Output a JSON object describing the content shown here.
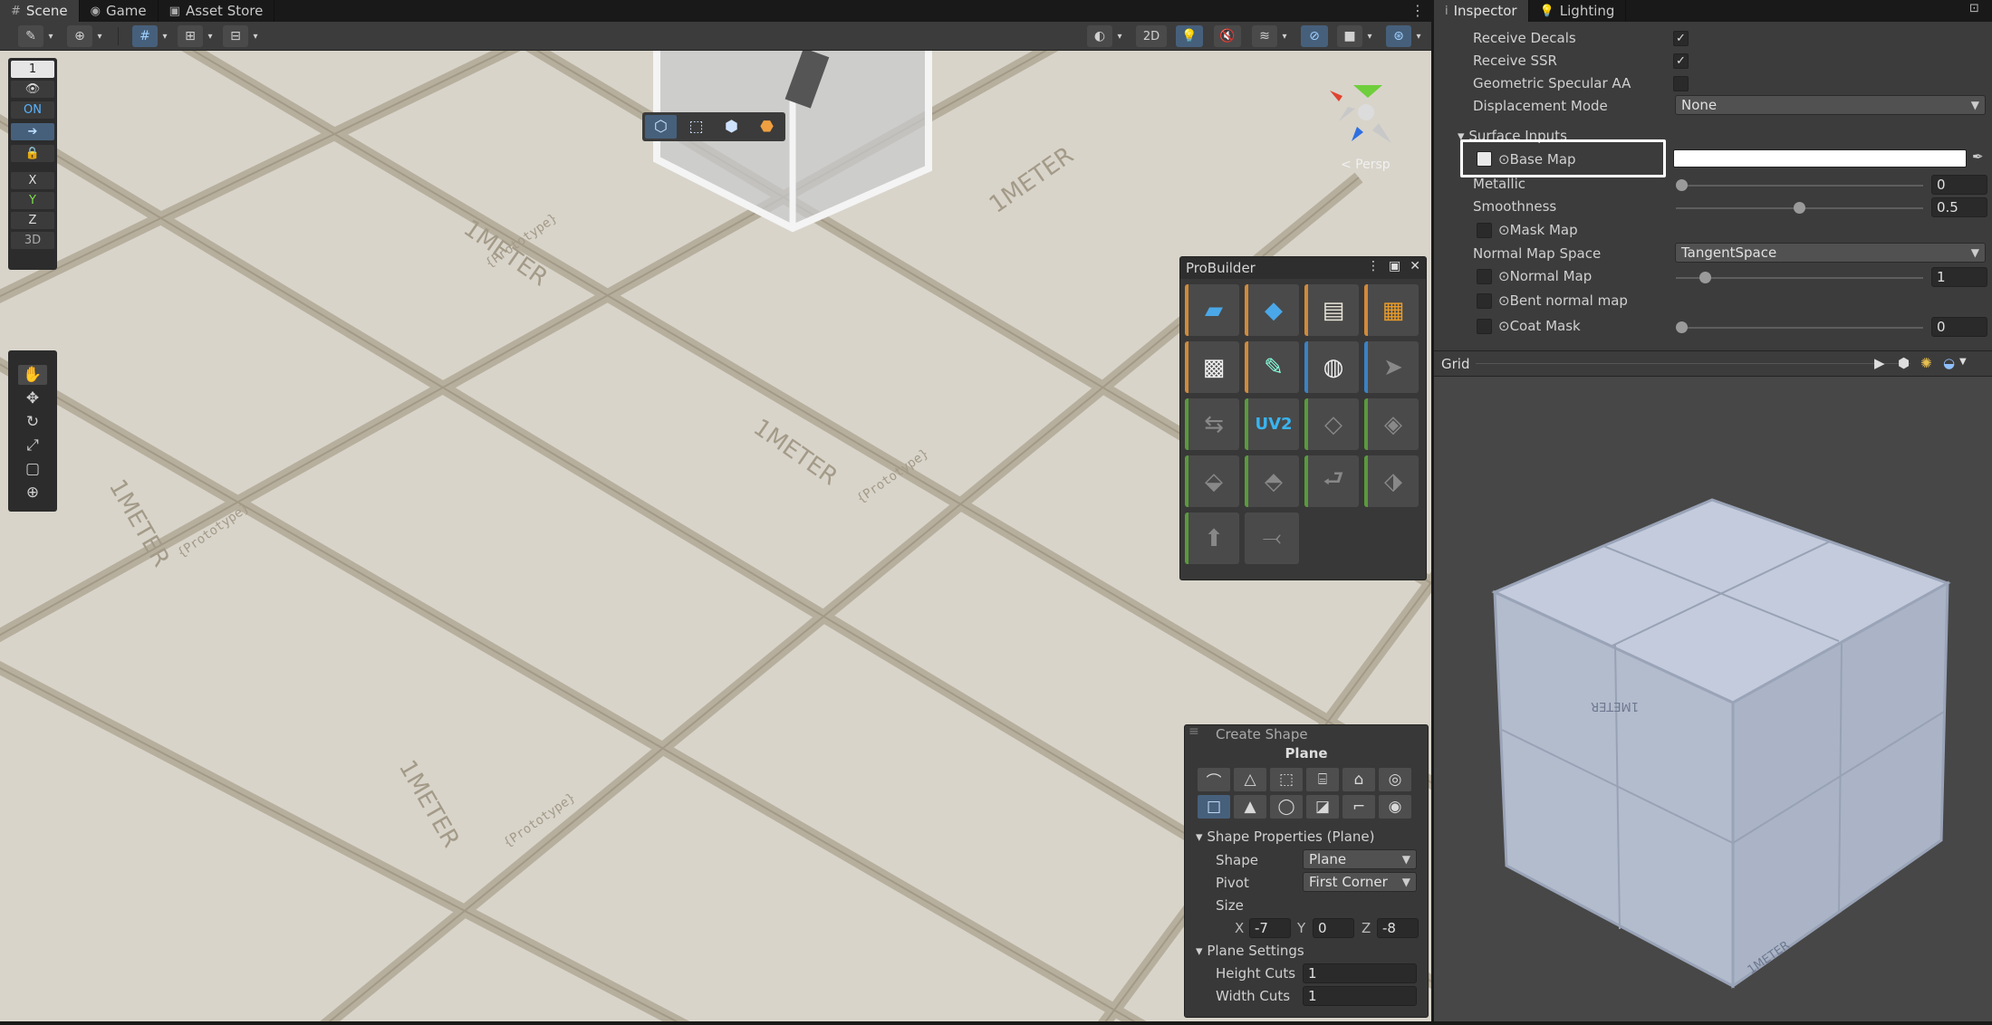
{
  "scene_tabs": [
    {
      "label": "Scene",
      "glyph": "#",
      "active": true
    },
    {
      "label": "Game",
      "glyph": "◉",
      "active": false
    },
    {
      "label": "Asset Store",
      "glyph": "▣",
      "active": false
    }
  ],
  "right_tabs": [
    {
      "label": "Inspector",
      "glyph": "i",
      "active": true
    },
    {
      "label": "Lighting",
      "glyph": "💡",
      "active": false
    }
  ],
  "scene_toolbar": {
    "view_2d_label": "2D"
  },
  "overlays": {
    "grid_size": "1",
    "snap_state": "ON",
    "axis_x": "X",
    "axis_y": "Y",
    "axis_z": "Z",
    "mode_3d": "3D"
  },
  "gizmo": {
    "persp_label": "< Persp"
  },
  "grid_labels": {
    "meter": "1METER",
    "prototype": "{Prototype}"
  },
  "probuilder": {
    "title": "ProBuilder",
    "uv2_label": "UV2"
  },
  "create_shape": {
    "title": "Create Shape",
    "shape_name": "Plane",
    "section_shape_props": "Shape Properties (Plane)",
    "shape_label": "Shape",
    "shape_value": "Plane",
    "pivot_label": "Pivot",
    "pivot_value": "First Corner",
    "size_label": "Size",
    "size_x_label": "X",
    "size_x": "-7",
    "size_y_label": "Y",
    "size_y": "0",
    "size_z_label": "Z",
    "size_z": "-8",
    "section_plane_settings": "Plane Settings",
    "height_cuts_label": "Height Cuts",
    "height_cuts": "1",
    "width_cuts_label": "Width Cuts",
    "width_cuts": "1"
  },
  "inspector": {
    "receive_decals_label": "Receive Decals",
    "receive_decals": true,
    "receive_ssr_label": "Receive SSR",
    "receive_ssr": true,
    "geo_specular_label": "Geometric Specular AA",
    "geo_specular": false,
    "displacement_label": "Displacement Mode",
    "displacement_value": "None",
    "surface_inputs_label": "Surface Inputs",
    "base_map_label": "Base Map",
    "base_map_color": "#ffffff",
    "metallic_label": "Metallic",
    "metallic_value": "0",
    "metallic_fraction": 0.0,
    "smoothness_label": "Smoothness",
    "smoothness_value": "0.5",
    "smoothness_fraction": 0.5,
    "mask_map_label": "Mask Map",
    "normal_space_label": "Normal Map Space",
    "normal_space_value": "TangentSpace",
    "normal_map_label": "Normal Map",
    "normal_map_value": "1",
    "normal_map_fraction": 0.1,
    "bent_normal_label": "Bent normal map",
    "coat_mask_label": "Coat Mask",
    "coat_mask_value": "0",
    "coat_mask_fraction": 0.0
  },
  "grid_preview": {
    "title": "Grid",
    "cube_label": "1METER"
  },
  "colors": {
    "accent": "#46607c",
    "selection_outline": "#ffffff",
    "floor": "#d8d4ca",
    "cube": "#b8c2d6"
  }
}
